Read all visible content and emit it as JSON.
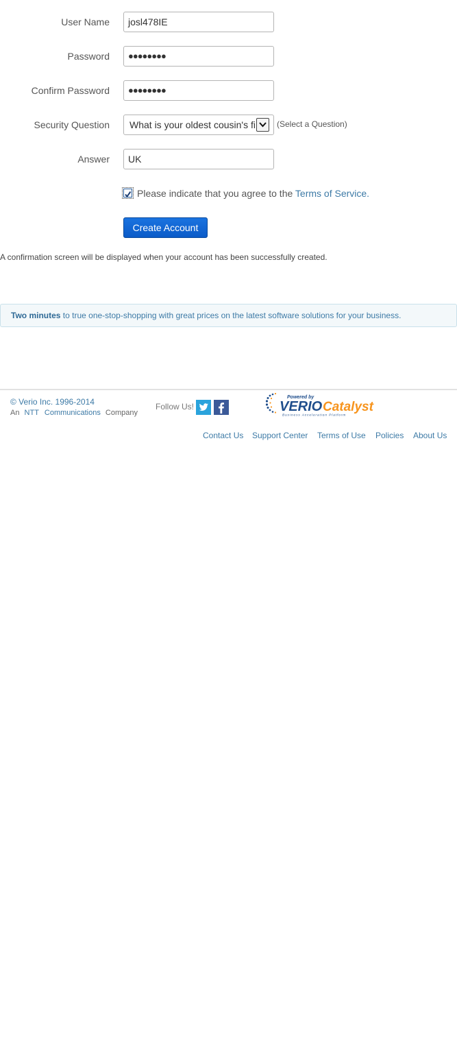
{
  "form": {
    "username": {
      "label": "User Name",
      "value": "josl478IE"
    },
    "password": {
      "label": "Password",
      "value": "●●●●●●●●"
    },
    "confirm_password": {
      "label": "Confirm Password",
      "value": "●●●●●●●●"
    },
    "security_question": {
      "label": "Security Question",
      "selected": "What is your oldest cousin's first name?",
      "hint": "(Select a Question)"
    },
    "answer": {
      "label": "Answer",
      "value": "UK"
    },
    "terms": {
      "checked": true,
      "text": "Please indicate that you agree to the",
      "link_text": "Terms of Service."
    },
    "submit_label": "Create Account",
    "confirmation_note": "A confirmation screen will be displayed when your account has been successfully created."
  },
  "promo": {
    "bold": "Two minutes",
    "text": "to true one-stop-shopping with great prices on the latest software solutions for your business."
  },
  "footer": {
    "copyright": "© Verio Inc. 1996-2014",
    "company_prefix": "An",
    "company_ntt": "NTT",
    "company_comm": "Communications",
    "company_suffix": "Company",
    "follow_label": "Follow Us!",
    "logo": {
      "powered_by": "Powered by",
      "brand": "VERIO",
      "product": "Catalyst",
      "tagline": "Business Acceleration Platform"
    },
    "links": [
      "Contact Us",
      "Support Center",
      "Terms of Use",
      "Policies",
      "About Us"
    ]
  },
  "colors": {
    "link": "#3d7aa6",
    "button": "#0b5bc8",
    "twitter": "#2aa3dc",
    "facebook": "#3b5998",
    "logo_orange": "#f7941d",
    "logo_blue": "#1f4e8c"
  },
  "icons": [
    "chevron-down-icon",
    "checkmark-icon",
    "twitter-icon",
    "facebook-icon"
  ]
}
